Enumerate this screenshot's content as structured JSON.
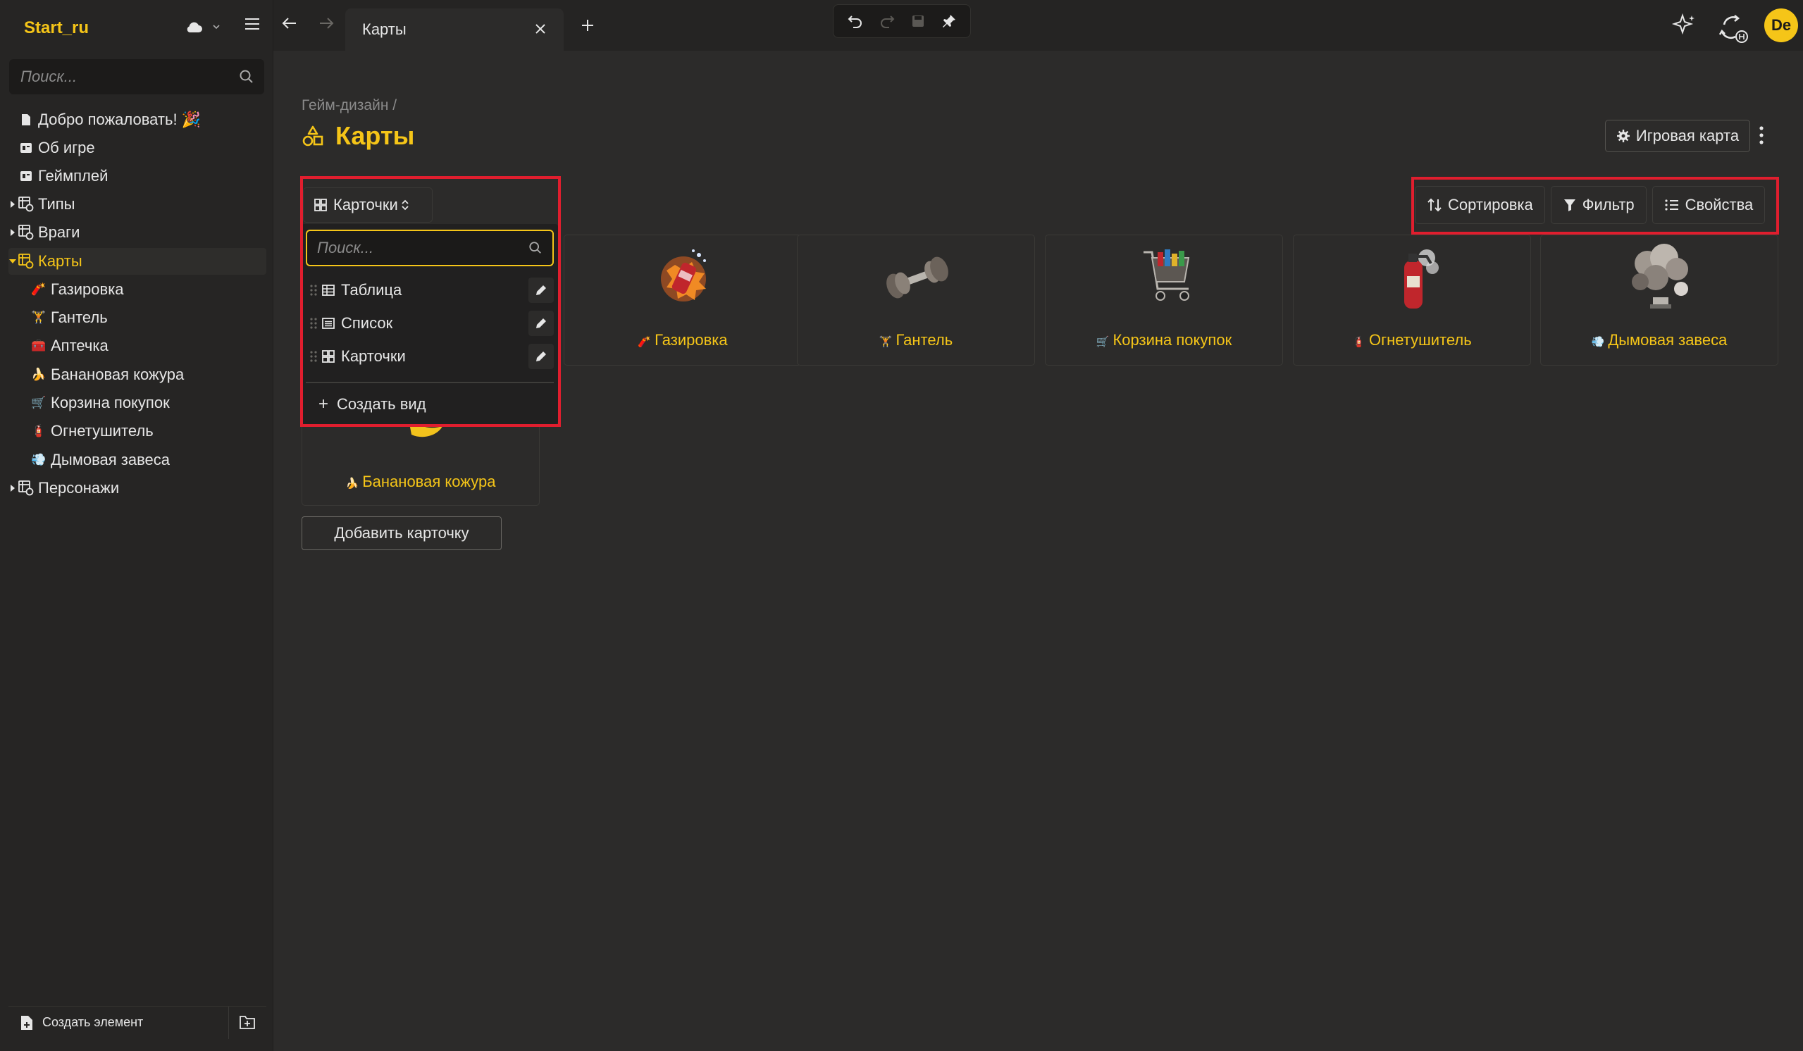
{
  "app": {
    "brand": "Start_ru",
    "search_placeholder": "Поиск...",
    "create_element": "Создать элемент"
  },
  "tab": {
    "title": "Карты"
  },
  "avatar": {
    "initials": "De"
  },
  "sidebar": {
    "items": [
      {
        "label": "Добро пожаловать! 🎉",
        "icon": "page-icon"
      },
      {
        "label": "Об игре",
        "icon": "doc-icon"
      },
      {
        "label": "Геймплей",
        "icon": "doc-icon"
      },
      {
        "label": "Типы",
        "icon": "database-icon"
      },
      {
        "label": "Враги",
        "icon": "database-icon"
      },
      {
        "label": "Карты",
        "icon": "database-icon",
        "active": true
      },
      {
        "label": "Персонажи",
        "icon": "database-icon"
      }
    ],
    "children": [
      {
        "label": "Газировка",
        "emoji": "🧨"
      },
      {
        "label": "Гантель",
        "emoji": "🏋"
      },
      {
        "label": "Аптечка",
        "emoji": "🧰"
      },
      {
        "label": "Банановая кожура",
        "emoji": "🍌"
      },
      {
        "label": "Корзина покупок",
        "emoji": "🛒"
      },
      {
        "label": "Огнетушитель",
        "emoji": "🧯"
      },
      {
        "label": "Дымовая завеса",
        "emoji": "💨"
      }
    ]
  },
  "page": {
    "breadcrumb": "Гейм-дизайн /",
    "title": "Карты",
    "game_map_button": "Игровая карта"
  },
  "view": {
    "current": "Карточки",
    "search_placeholder": "Поиск...",
    "options": [
      "Таблица",
      "Список",
      "Карточки"
    ],
    "create_view": "Создать вид"
  },
  "toolbar": {
    "sort": "Сортировка",
    "filter": "Фильтр",
    "properties": "Свойства"
  },
  "cards": [
    {
      "title": "Газировка",
      "emoji": "🧨"
    },
    {
      "title": "Гантель",
      "emoji": "🏋"
    },
    {
      "title": "Корзина покупок",
      "emoji": "🛒"
    },
    {
      "title": "Огнетушитель",
      "emoji": "🧯"
    },
    {
      "title": "Дымовая завеса",
      "emoji": "💨"
    },
    {
      "title": "Банановая кожура",
      "emoji": "🍌"
    }
  ],
  "add_card": "Добавить карточку",
  "colors": {
    "accent": "#f5c518",
    "highlight": "#e01e2e",
    "background": "#2c2b2a",
    "sidebar": "#262524"
  }
}
